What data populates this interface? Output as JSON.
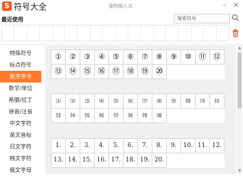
{
  "app": {
    "title": "符号大全",
    "window_subtitle": "搜狗输入法",
    "logo_glyph": "S"
  },
  "window_controls": {
    "minimize": "–",
    "close": "×"
  },
  "recent": {
    "label": "最近使用",
    "cells": [
      "",
      "",
      "",
      "",
      "",
      "",
      "",
      "",
      "",
      "",
      "",
      "",
      "",
      "",
      "",
      "",
      "",
      ""
    ]
  },
  "search": {
    "placeholder": "搜索符号"
  },
  "sidebar": {
    "items": [
      {
        "label": "特殊符号"
      },
      {
        "label": "标点符号"
      },
      {
        "label": "数字序号"
      },
      {
        "label": "数学/单位"
      },
      {
        "label": "希腊/拉丁"
      },
      {
        "label": "拼音/注音"
      },
      {
        "label": "中文字符"
      },
      {
        "label": "英文音标"
      },
      {
        "label": "日文字符"
      },
      {
        "label": "韩文字符"
      },
      {
        "label": "俄文字母"
      }
    ],
    "active_index": 2
  },
  "symbol_groups": [
    {
      "symbols": [
        "①",
        "②",
        "③",
        "④",
        "⑤",
        "⑥",
        "⑦",
        "⑧",
        "⑨",
        "⑩",
        "⑪",
        "⑫",
        "⑬",
        "⑭",
        "⑮",
        "⑯",
        "⑰",
        "⑱",
        "⑲",
        "⑳"
      ]
    },
    {
      "symbols": [
        "⑴",
        "⑵",
        "⑶",
        "⑷",
        "⑸",
        "⑹",
        "⑺",
        "⑻",
        "⑼",
        "⑽",
        "⑾",
        "⑿",
        "⒀",
        "⒁",
        "⒂",
        "⒃",
        "⒄",
        "⒅",
        "⒆",
        "⒇"
      ]
    },
    {
      "symbols": [
        "1.",
        "2.",
        "3.",
        "4.",
        "5.",
        "6.",
        "7.",
        "8.",
        "9.",
        "10.",
        "11.",
        "12.",
        "13.",
        "14.",
        "15.",
        "16.",
        "17.",
        "18.",
        "19.",
        "20."
      ]
    }
  ],
  "colors": {
    "accent": "#ff7a2e",
    "logo": "#f25a1a",
    "panel_bg": "#f0f0f0",
    "trash": "#e8533a"
  }
}
